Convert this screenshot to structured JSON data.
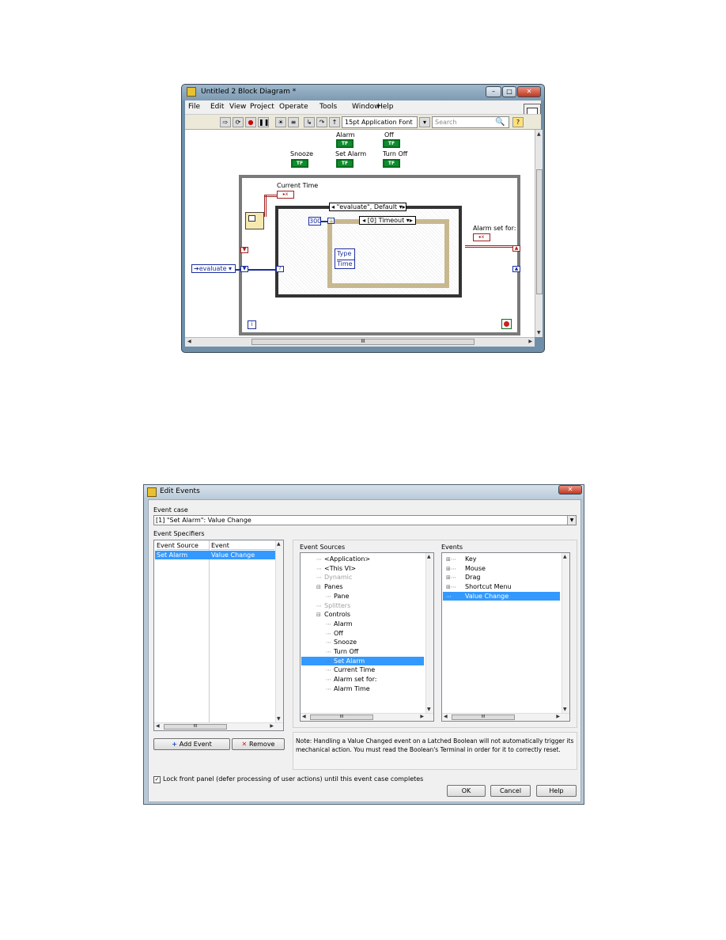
{
  "block_diagram": {
    "title": "Untitled 2 Block Diagram *",
    "menu": [
      "File",
      "Edit",
      "View",
      "Project",
      "Operate",
      "Tools",
      "Window",
      "Help"
    ],
    "font_selector": "15pt Application Font",
    "search_placeholder": "Search",
    "controls": {
      "alarm": "Alarm",
      "off": "Off",
      "snooze": "Snooze",
      "set_alarm": "Set Alarm",
      "turn_off": "Turn Off",
      "bool_text": "TF",
      "current_time": "Current Time",
      "alarm_set_for": "Alarm set for:"
    },
    "case_selector": "\"evaluate\", Default",
    "enum_value": "evaluate",
    "timeout_value": "300",
    "event_selector": "[0] Timeout",
    "event_data": [
      "Type",
      "Time"
    ],
    "iteration_terminal": "i",
    "scroll_label": "III"
  },
  "edit_events": {
    "title": "Edit Events",
    "event_case_label": "Event case",
    "event_case_value": "[1] \"Set Alarm\": Value Change",
    "event_specifiers_label": "Event Specifiers",
    "specifier_headers": [
      "Event Source",
      "Event"
    ],
    "specifier_rows": [
      [
        "Set Alarm",
        "Value Change"
      ]
    ],
    "event_sources_label": "Event Sources",
    "event_sources": [
      {
        "label": "<Application>",
        "level": 1,
        "dim": false,
        "selected": false
      },
      {
        "label": "<This VI>",
        "level": 1,
        "dim": false,
        "selected": false
      },
      {
        "label": "Dynamic",
        "level": 1,
        "dim": true,
        "selected": false
      },
      {
        "label": "Panes",
        "level": 1,
        "dim": false,
        "selected": false,
        "expander": "-"
      },
      {
        "label": "Pane",
        "level": 2,
        "dim": false,
        "selected": false
      },
      {
        "label": "Splitters",
        "level": 1,
        "dim": true,
        "selected": false
      },
      {
        "label": "Controls",
        "level": 1,
        "dim": false,
        "selected": false,
        "expander": "-"
      },
      {
        "label": "Alarm",
        "level": 2,
        "dim": false,
        "selected": false
      },
      {
        "label": "Off",
        "level": 2,
        "dim": false,
        "selected": false
      },
      {
        "label": "Snooze",
        "level": 2,
        "dim": false,
        "selected": false
      },
      {
        "label": "Turn Off",
        "level": 2,
        "dim": false,
        "selected": false
      },
      {
        "label": "Set Alarm",
        "level": 2,
        "dim": false,
        "selected": true
      },
      {
        "label": "Current Time",
        "level": 2,
        "dim": false,
        "selected": false
      },
      {
        "label": "Alarm set for:",
        "level": 2,
        "dim": false,
        "selected": false
      },
      {
        "label": "Alarm Time",
        "level": 2,
        "dim": false,
        "selected": false
      }
    ],
    "events_label": "Events",
    "events": [
      {
        "label": "Key",
        "expander": "+",
        "selected": false
      },
      {
        "label": "Mouse",
        "expander": "+",
        "selected": false
      },
      {
        "label": "Drag",
        "expander": "+",
        "selected": false
      },
      {
        "label": "Shortcut Menu",
        "expander": "+",
        "selected": false
      },
      {
        "label": "Value Change",
        "expander": "",
        "selected": true
      }
    ],
    "add_event": "Add Event",
    "remove": "Remove",
    "note": "Note: Handling a Value Changed event on a Latched Boolean will not automatically trigger its mechanical action. You must read the Boolean's Terminal in order for it to correctly reset.",
    "lock_label": "Lock front panel (defer processing of user actions) until this event case completes",
    "lock_checked": true,
    "ok": "OK",
    "cancel": "Cancel",
    "help": "Help",
    "scroll_label": "III"
  }
}
